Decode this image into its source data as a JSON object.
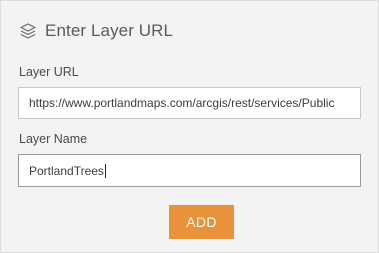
{
  "header": {
    "icon": "layers-icon",
    "title": "Enter Layer URL"
  },
  "form": {
    "url_label": "Layer URL",
    "url_value": "https://www.portlandmaps.com/arcgis/rest/services/Public",
    "name_label": "Layer Name",
    "name_value": "PortlandTrees"
  },
  "actions": {
    "add_label": "ADD"
  },
  "colors": {
    "accent": "#e8923a",
    "panel_bg": "#f3f3f3"
  }
}
